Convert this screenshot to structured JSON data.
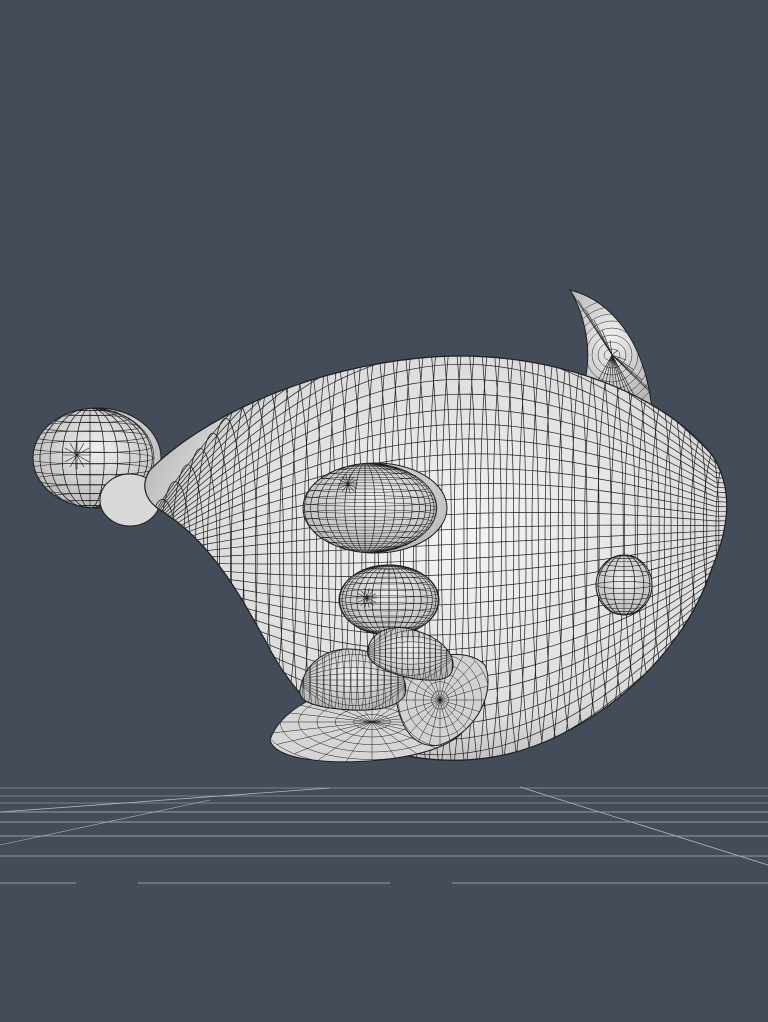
{
  "viewport": {
    "background_color": "#434c58",
    "mesh_fill_color": "#e6e6e6",
    "mesh_line_color": "#1e1e1e",
    "grid_line_color": "#b4b8be",
    "display_mode": "wireframe-on-shaded",
    "object": "mouse-creature-mesh",
    "ground_grid": true
  }
}
